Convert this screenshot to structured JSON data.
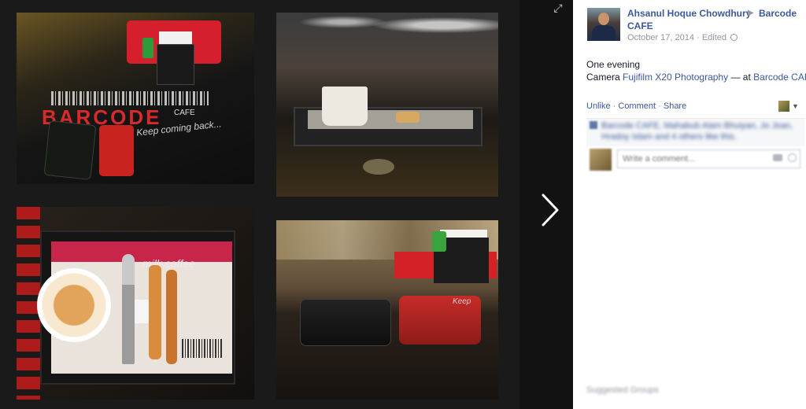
{
  "post": {
    "author": "Ahsanul Hoque Chowdhury",
    "place_line1": "Barcode",
    "place_line2": "CAFE",
    "date": "October 17, 2014",
    "edited": "Edited",
    "caption_line1": "One evening",
    "caption_prefix": "Camera",
    "caption_link": "Fujifilm X20 Photography",
    "caption_at": "— at",
    "caption_place": "Barcode CAFE."
  },
  "actions": {
    "unlike": "Unlike",
    "comment": "Comment",
    "share": "Share"
  },
  "likes": {
    "text": "Barcode CAFE, Mahabub Alam Bhuiyan, Jo Joan, Hradoy Islam and 4 others like this."
  },
  "comment_box": {
    "placeholder": "Write a comment..."
  },
  "photos": {
    "p1_brand": "BARCODE",
    "p1_brand_sub": "CAFE",
    "p1_tagline": "Keep coming back...",
    "p3_brand": "milk coffee",
    "p4_table_text": "Keep"
  },
  "footer": {
    "suggested": "Suggested Groups"
  },
  "icons": {
    "expand": "expand-icon",
    "next": "chevron-right-icon",
    "globe": "globe-icon",
    "caret": "caret-down-icon",
    "like": "like-icon",
    "camera": "camera-icon",
    "sticker": "sticker-icon"
  },
  "colors": {
    "link": "#3b5998",
    "meta": "#9197a3",
    "viewer_bg": "#121212"
  }
}
